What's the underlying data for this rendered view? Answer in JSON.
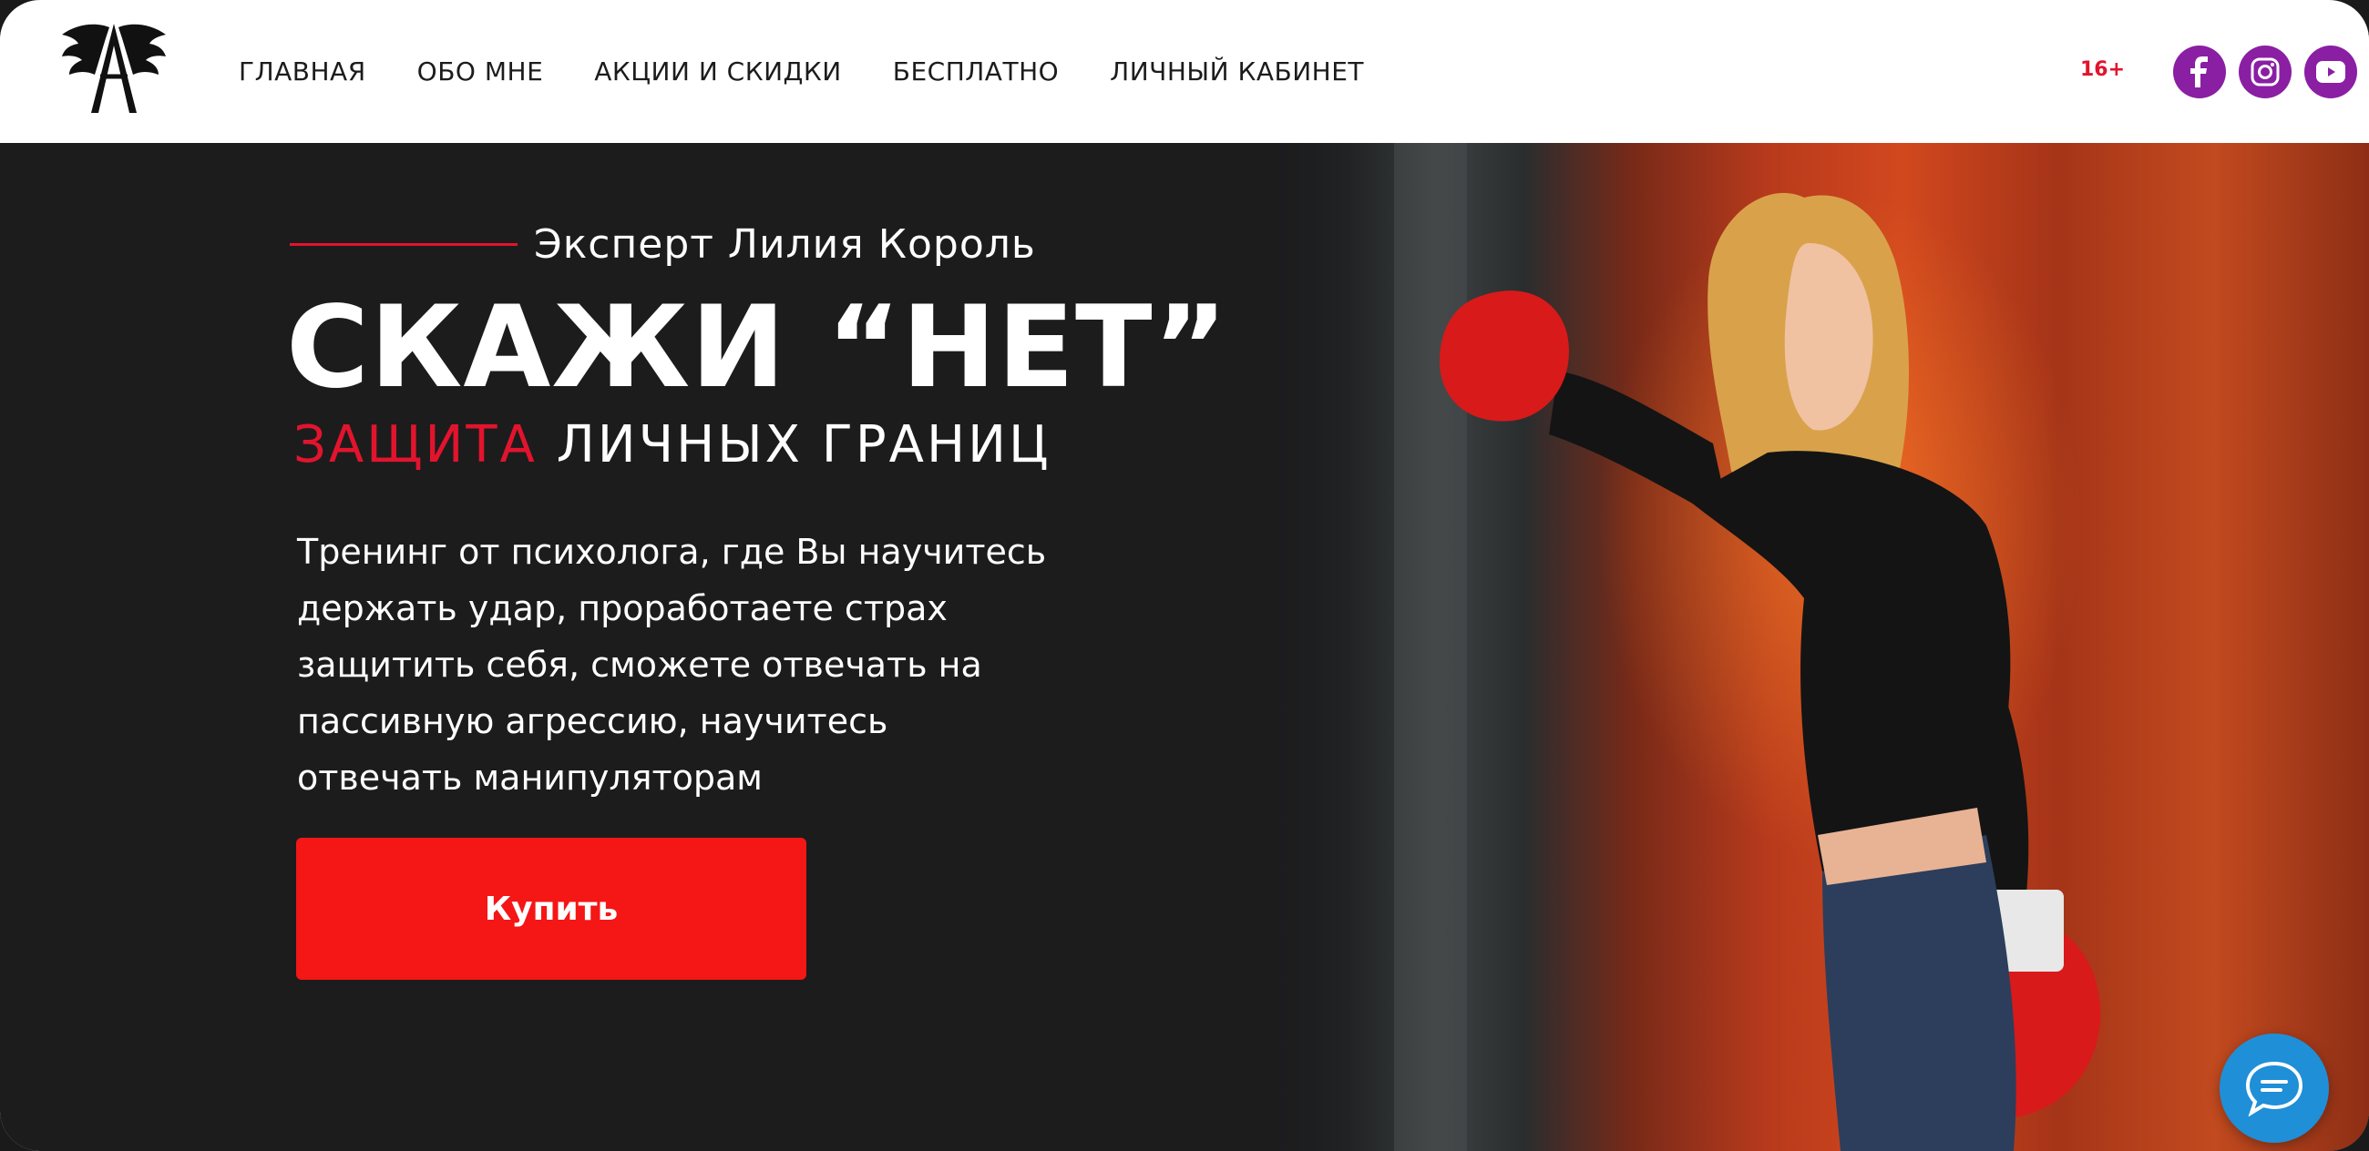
{
  "header": {
    "nav": [
      {
        "label": "ГЛАВНАЯ"
      },
      {
        "label": "ОБО МНЕ"
      },
      {
        "label": "АКЦИИ И СКИДКИ"
      },
      {
        "label": "БЕСПЛАТНО"
      },
      {
        "label": "ЛИЧНЫЙ КАБИНЕТ"
      }
    ],
    "age_rating": "16+",
    "social": [
      {
        "icon": "facebook-icon"
      },
      {
        "icon": "instagram-icon"
      },
      {
        "icon": "youtube-icon"
      }
    ],
    "social_color": "#8a1fa3"
  },
  "hero": {
    "expert": "Эксперт Лилия Король",
    "title": "СКАЖИ “НЕТ”",
    "tagline_accent": "ЗАЩИТА",
    "tagline_rest": "ЛИЧНЫХ ГРАНИЦ",
    "description_lines": [
      "Тренинг от психолога, где Вы научитесь",
      "держать удар, проработаете страх",
      "защитить себя, сможете отвечать на",
      "пассивную агрессию, научитесь",
      "отвечать манипуляторам"
    ],
    "buy_label": "Купить",
    "accent_color": "#e2142d",
    "button_color": "#f51616"
  },
  "chat": {
    "icon": "chat-bubble-icon",
    "color": "#1f8fd8"
  }
}
